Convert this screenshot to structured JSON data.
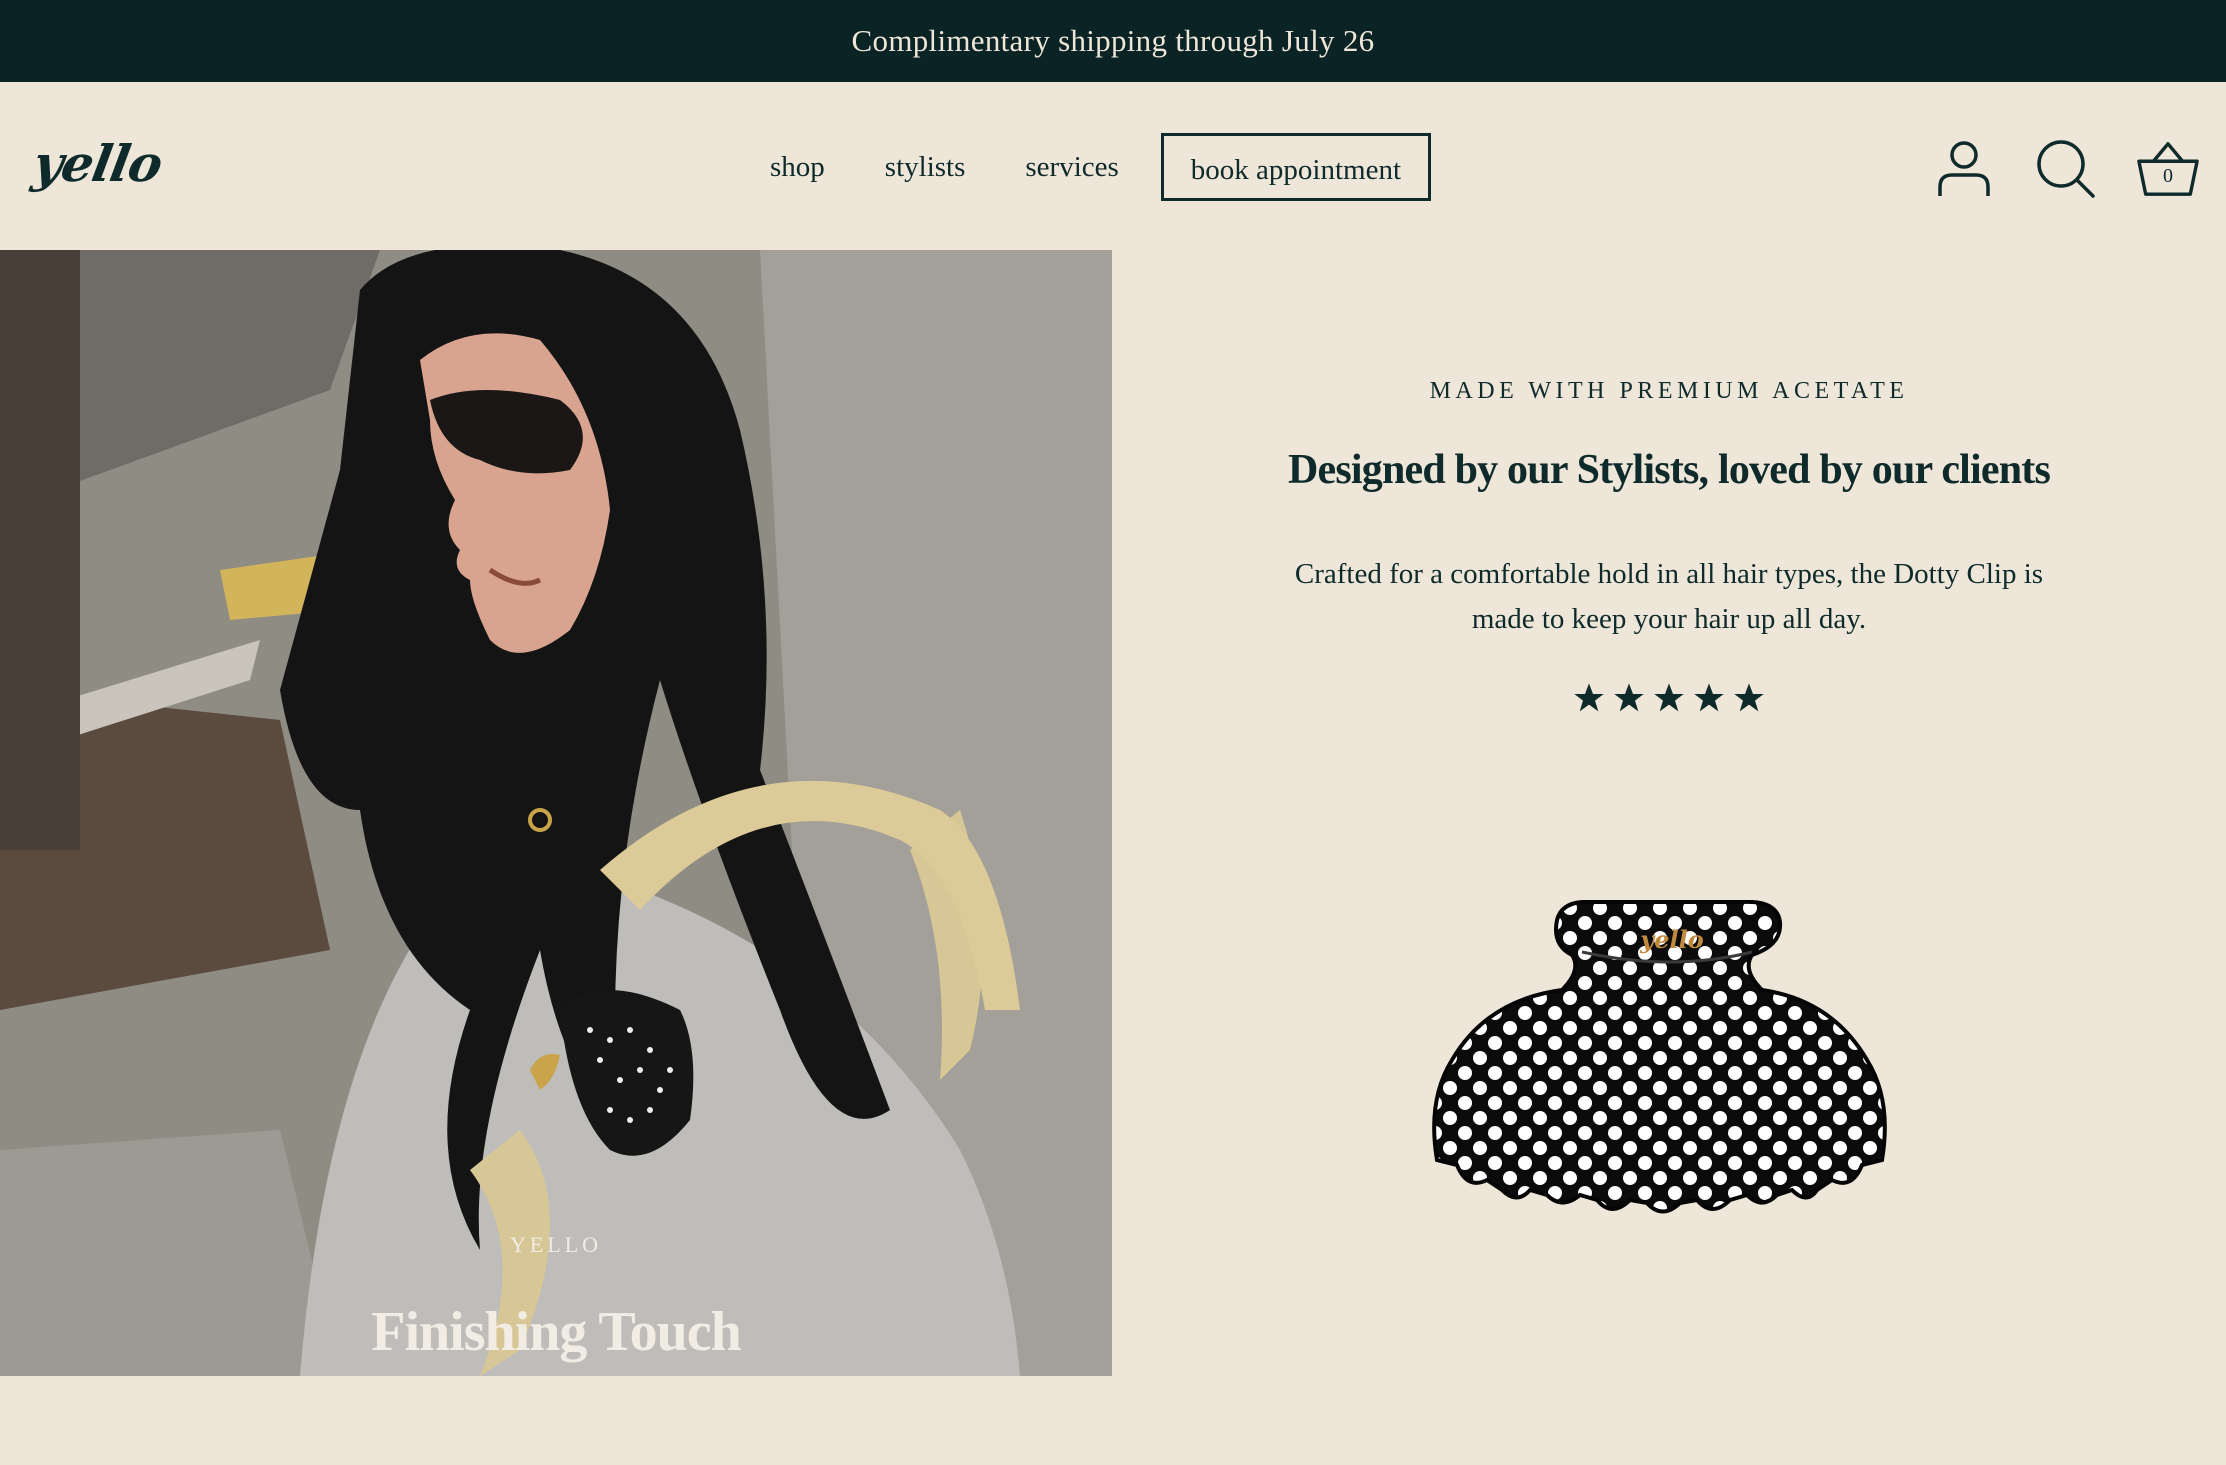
{
  "announcement": {
    "text": "Complimentary shipping through July 26"
  },
  "header": {
    "logo": "yello",
    "nav": [
      {
        "label": "shop"
      },
      {
        "label": "stylists"
      },
      {
        "label": "services"
      }
    ],
    "book_label": "book appointment",
    "icons": {
      "account": "account-icon",
      "search": "search-icon",
      "cart": "cart-icon"
    },
    "cart_count": "0"
  },
  "hero": {
    "eyebrow": "YELLO",
    "title": "Finishing Touch"
  },
  "feature": {
    "eyebrow": "MADE WITH PREMIUM ACETATE",
    "heading": "Designed by our Stylists, loved by our clients",
    "description": "Crafted for a comfortable hold in all hair types, the Dotty Clip is made to keep your hair up all day.",
    "rating": 5,
    "rating_max": 5,
    "product_logo": "yello"
  },
  "colors": {
    "dark": "#0A2325",
    "text": "#0E2A2B",
    "background": "#EEE6D8"
  }
}
